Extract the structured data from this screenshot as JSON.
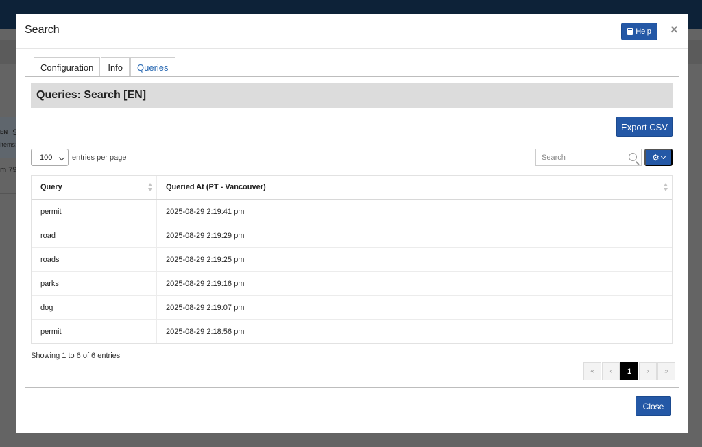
{
  "background": {
    "badge": "EN",
    "frag_s": "S",
    "frag_items": "Items:",
    "frag_m": "m 79"
  },
  "modal": {
    "title": "Search",
    "help_label": "Help",
    "close_x": "×",
    "close_label": "Close"
  },
  "tabs": [
    {
      "label": "Configuration",
      "active": false
    },
    {
      "label": "Info",
      "active": false
    },
    {
      "label": "Queries",
      "active": true
    }
  ],
  "panel": {
    "heading": "Queries: Search [EN]",
    "export_label": "Export CSV",
    "length_value": "100",
    "length_label": "entries per page",
    "search_placeholder": "Search"
  },
  "table": {
    "columns": [
      "Query",
      "Queried At (PT - Vancouver)"
    ],
    "rows": [
      [
        "permit",
        "2025-08-29 2:19:41 pm"
      ],
      [
        "road",
        "2025-08-29 2:19:29 pm"
      ],
      [
        "roads",
        "2025-08-29 2:19:25 pm"
      ],
      [
        "parks",
        "2025-08-29 2:19:16 pm"
      ],
      [
        "dog",
        "2025-08-29 2:19:07 pm"
      ],
      [
        "permit",
        "2025-08-29 2:18:56 pm"
      ]
    ]
  },
  "info": "Showing 1 to 6 of 6 entries",
  "pagination": {
    "first": "«",
    "prev": "‹",
    "current": "1",
    "next": "›",
    "last": "»"
  },
  "colors": {
    "primary": "#2458a6",
    "topbar": "#0d2238",
    "active_tab": "#2a6ab3"
  }
}
